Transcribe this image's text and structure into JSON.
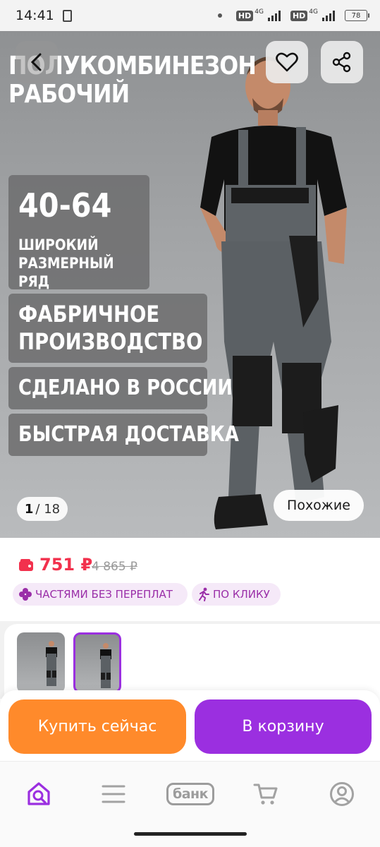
{
  "status_bar": {
    "time": "14:41",
    "hd1": "HD",
    "net1": "4G",
    "hd2": "HD",
    "net2": "4G",
    "battery": "78"
  },
  "hero": {
    "title": "ПОЛУКОМБИНЕЗОН РАБОЧИЙ",
    "size_range": "40-64",
    "size_caption": "ШИРОКИЙ РАЗМЕРНЫЙ РЯД",
    "factory_line1": "ФАБРИЧНОЕ",
    "factory_line2": "ПРОИЗВОДСТВО",
    "made_in": "СДЕЛАНО В РОССИИ",
    "delivery": "БЫСТРАЯ ДОСТАВКА",
    "counter_current": "1",
    "counter_total": "/ 18",
    "similar_label": "Похожие",
    "icons": [
      "back-arrow-icon",
      "heart-icon",
      "share-icon"
    ]
  },
  "price": {
    "current": "751 ₽",
    "old": "4 865 ₽",
    "accent_color": "#f2314d",
    "chip_parts": "ЧАСТЯМИ БЕЗ ПЕРЕПЛАТ",
    "chip_click": "ПО КЛИКУ"
  },
  "actions": {
    "buy_now": "Купить сейчас",
    "add_to_cart": "В корзину",
    "buy_color": "#ff8a2b",
    "cart_color": "#9b2fe0"
  },
  "bottom_nav": {
    "bank_label": "банк",
    "items": [
      "home-search-icon",
      "catalog-icon",
      "bank-icon",
      "cart-icon",
      "profile-icon"
    ],
    "active_color": "#9b2fe0"
  }
}
